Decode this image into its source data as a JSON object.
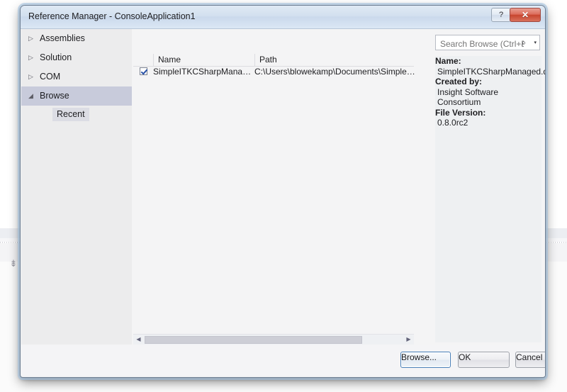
{
  "window": {
    "title": "Reference Manager - ConsoleApplication1",
    "help_label": "?",
    "close_label": "✕"
  },
  "nav": {
    "items": [
      {
        "label": "Assemblies",
        "twisty": "▷",
        "selected": false
      },
      {
        "label": "Solution",
        "twisty": "▷",
        "selected": false
      },
      {
        "label": "COM",
        "twisty": "▷",
        "selected": false
      },
      {
        "label": "Browse",
        "twisty": "◢",
        "selected": true
      }
    ],
    "child": {
      "label": "Recent"
    }
  },
  "search": {
    "placeholder": "Search Browse (Ctrl+E)",
    "value": "",
    "icon": "⌕",
    "caret": "▾"
  },
  "list": {
    "columns": [
      "",
      "Name",
      "Path"
    ],
    "rows": [
      {
        "checked": true,
        "name": "SimpleITKCSharpManag...",
        "path": "C:\\Users\\blowekamp\\Documents\\SimpleITK"
      }
    ],
    "scrollbar": {
      "left_arrow": "◀",
      "right_arrow": "▶"
    }
  },
  "details": {
    "name_label": "Name:",
    "name_value": "SimpleITKCSharpManaged.dll",
    "createdby_label": "Created by:",
    "createdby_value": "Insight Software Consortium",
    "fileversion_label": "File Version:",
    "fileversion_value": "0.8.0rc2"
  },
  "footer": {
    "browse_label": "Browse...",
    "ok_label": "OK",
    "cancel_label": "Cancel"
  },
  "background": {
    "toolbar_glyph": "⇟"
  },
  "colors": {
    "accent": "#c8cbdb",
    "close_red": "#c8452f",
    "focus_blue": "#4a80b8",
    "check_blue": "#2a53a8"
  }
}
